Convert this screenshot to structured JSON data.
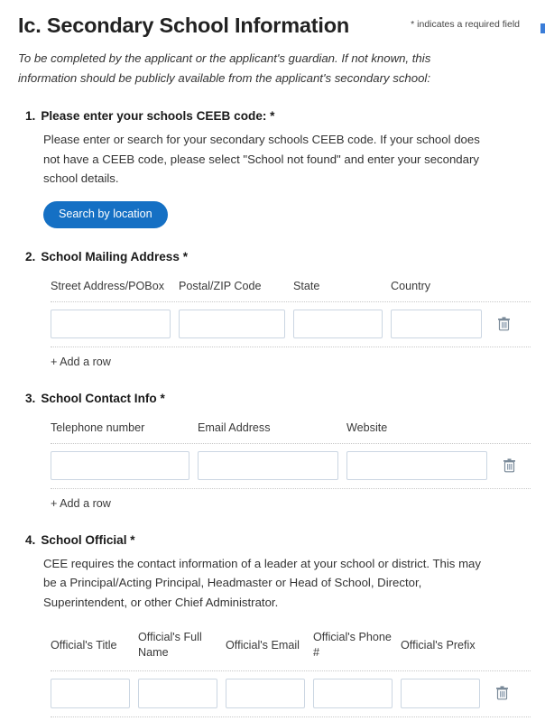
{
  "header": {
    "title": "Ic. Secondary School Information",
    "required_note": "* indicates a required field",
    "intro": "To be completed by the applicant or the applicant's guardian. If not known, this information should be publicly available from the applicant's secondary school:"
  },
  "icons": {
    "trash": "trash-icon"
  },
  "colors": {
    "button_blue": "#1570c4",
    "input_border": "#cbd6e2",
    "separator": "#c8c8c8",
    "text": "#333333"
  },
  "questions": [
    {
      "number": "1.",
      "title": "Please enter your schools CEEB code: *",
      "description": "Please enter or search for your secondary schools CEEB code. If your school does not have a CEEB code, please select \"School not found\" and enter your secondary school details.",
      "button_label": "Search by location"
    },
    {
      "number": "2.",
      "title": "School Mailing Address *",
      "columns": [
        "Street Address/POBox",
        "Postal/ZIP Code",
        "State",
        "Country"
      ],
      "values": [
        "",
        "",
        "",
        ""
      ],
      "add_row_label": "+ Add a row"
    },
    {
      "number": "3.",
      "title": "School Contact Info *",
      "columns": [
        "Telephone number",
        "Email Address",
        "Website"
      ],
      "values": [
        "",
        "",
        ""
      ],
      "add_row_label": "+ Add a row"
    },
    {
      "number": "4.",
      "title": "School Official *",
      "description": "CEE requires the contact information of a leader at your school or district. This may be a Principal/Acting Principal, Headmaster or Head of School, Director, Superintendent, or other Chief Administrator.",
      "columns": [
        "Official's Title",
        "Official's Full Name",
        "Official's Email",
        "Official's Phone #",
        "Official's Prefix"
      ],
      "values": [
        "",
        "",
        "",
        "",
        ""
      ]
    }
  ]
}
